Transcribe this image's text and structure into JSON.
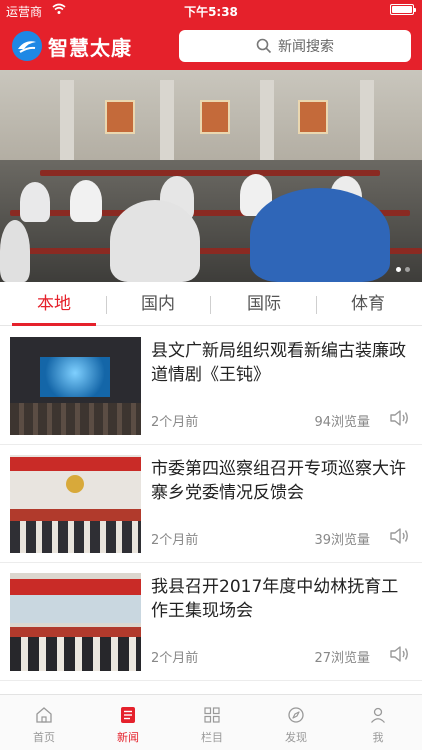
{
  "status": {
    "carrier": "运营商",
    "time": "下午5:38"
  },
  "header": {
    "app_title": "智慧太康",
    "search_placeholder": "新闻搜索"
  },
  "tabs": [
    {
      "label": "本地",
      "active": true
    },
    {
      "label": "国内",
      "active": false
    },
    {
      "label": "国际",
      "active": false
    },
    {
      "label": "体育",
      "active": false
    }
  ],
  "news": [
    {
      "title": "县文广新局组织观看新编古装廉政道情剧《王钝》",
      "time": "2个月前",
      "views": "94浏览量"
    },
    {
      "title": "市委第四巡察组召开专项巡察大许寨乡党委情况反馈会",
      "time": "2个月前",
      "views": "39浏览量"
    },
    {
      "title": "我县召开2017年度中幼林抚育工作王集现场会",
      "time": "2个月前",
      "views": "27浏览量"
    }
  ],
  "tabbar": [
    {
      "label": "首页",
      "icon": "home-icon",
      "active": false
    },
    {
      "label": "新闻",
      "icon": "news-icon",
      "active": true
    },
    {
      "label": "栏目",
      "icon": "grid-icon",
      "active": false
    },
    {
      "label": "发现",
      "icon": "compass-icon",
      "active": false
    },
    {
      "label": "我",
      "icon": "person-icon",
      "active": false
    }
  ],
  "colors": {
    "accent": "#e5212b",
    "logo": "#1e88e5"
  }
}
